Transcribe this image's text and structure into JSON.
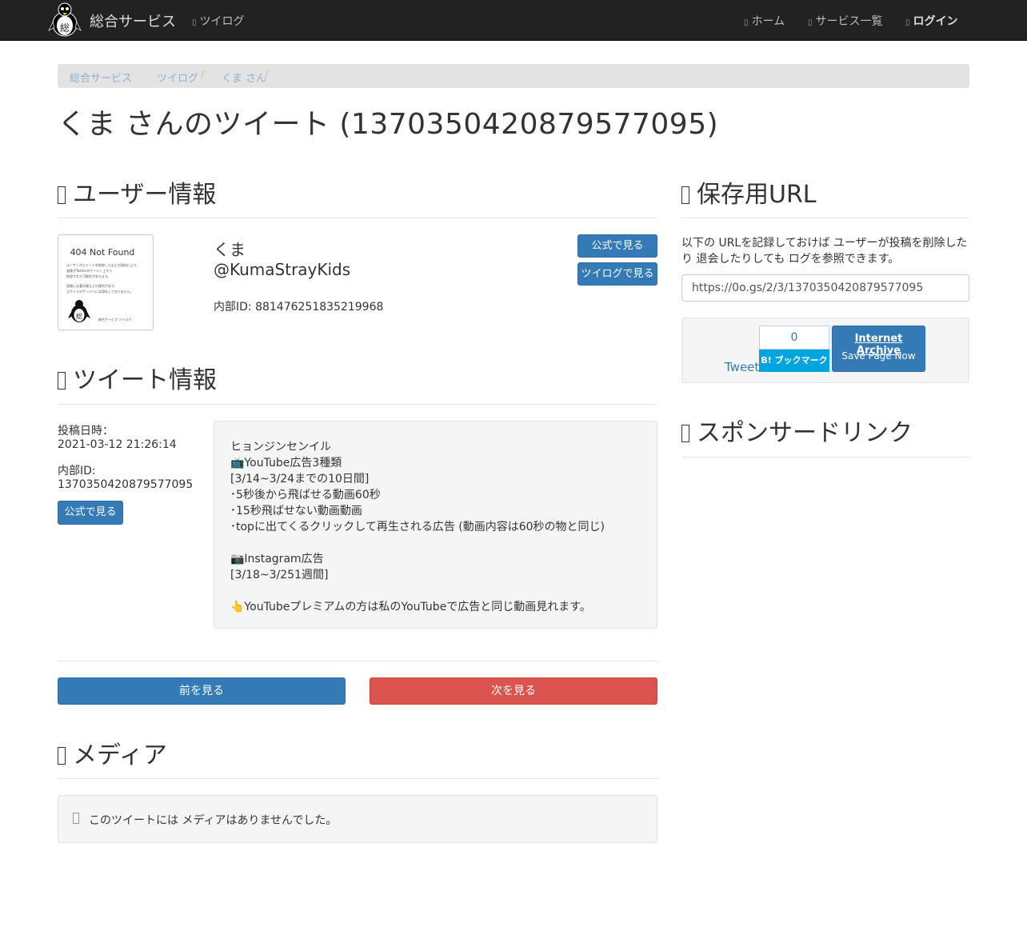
{
  "navbar": {
    "brand": "総合サービス",
    "tweetlog": "ツイログ",
    "home": "ホーム",
    "services": "サービス一覧",
    "login": "ログイン",
    "logo_char": "総"
  },
  "breadcrumb": [
    "総合サービス",
    "ツイログ",
    "くま さん"
  ],
  "page_title": "くま さんのツイート (1370350420879577095)",
  "user_section": {
    "heading": "ユーザー情報",
    "avatar_title": "404 Not Found",
    "avatar_lines": [
      "ユーザーがツイートを削除したなどの理由により、",
      "画像がTwitterのサーバー上から",
      "削除された可能性があります。",
      "",
      "画像には著作権などの権利があり、",
      "当サイトのサーバーには保存しておりません。"
    ],
    "avatar_footer": "総合サービス ツイログ",
    "avatar_logo_char": "総",
    "name": "くま",
    "handle": "@KumaStrayKids",
    "internal_id": "内部ID: 881476251835219968",
    "official_btn": "公式で見る",
    "tweetlog_btn": "ツイログで見る"
  },
  "tweet_section": {
    "heading": "ツイート情報",
    "posted_label": "投稿日時：",
    "posted_value": "2021-03-12 21:26:14",
    "id_label": "内部ID:",
    "id_value": "1370350420879577095",
    "official_btn": "公式で見る",
    "body_lines": [
      "ヒョンジンセンイル",
      "📺YouTube広告3種類",
      "[3/14~3/24までの10日間]",
      "･5秒後から飛ばせる動画60秒",
      "･15秒飛ばせない動画動画",
      "･topに出てくるクリックして再生される広告 (動画内容は60秒の物と同じ)",
      "",
      "📷Instagram広告",
      "[3/18~3/251週間]",
      "",
      "👆YouTubeプレミアムの方は私のYouTubeで広告と同じ動画見れます。"
    ]
  },
  "nav_buttons": {
    "prev": "前を見る",
    "next": "次を見る"
  },
  "media_section": {
    "heading": "メディア",
    "empty_text": "このツイートには メディアはありませんでした。"
  },
  "save_section": {
    "heading": "保存用URL",
    "description": "以下の URLを記録しておけば ユーザーが投稿を削除したり 退会したりしても ログを参照できます。",
    "url": "https://0o.gs/2/3/1370350420879577095",
    "tweet_link": "Tweet",
    "hatena_count": "0",
    "hatena_label": "B! ブックマーク",
    "ia_title": "Internet Archive",
    "ia_sub": "Save Page Now"
  },
  "sponsor_section": {
    "heading": "スポンサードリンク"
  }
}
